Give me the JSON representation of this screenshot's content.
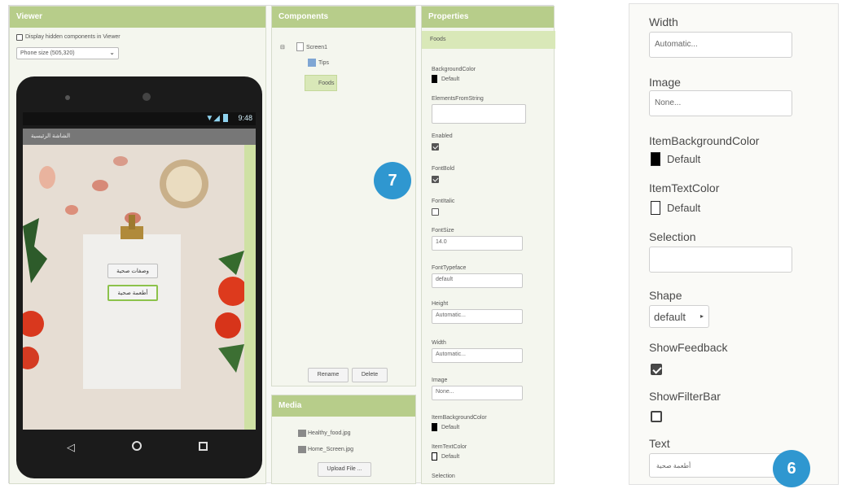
{
  "viewer": {
    "title": "Viewer",
    "hidden_components_label": "Display hidden components in Viewer",
    "phone_size": "Phone size (505,320)",
    "status_time": "9:48",
    "screen_title": "الشاشة الرئيسية",
    "buttons": [
      "وصفات صحية",
      "أطعمة صحية"
    ]
  },
  "components": {
    "title": "Components",
    "tree": [
      {
        "label": "Screen1",
        "level": 0
      },
      {
        "label": "Tips",
        "level": 1
      },
      {
        "label": "Foods",
        "level": 1
      }
    ],
    "rename_label": "Rename",
    "delete_label": "Delete"
  },
  "media": {
    "title": "Media",
    "files": [
      "Healthy_food.jpg",
      "Home_Screen.jpg"
    ],
    "upload_label": "Upload File ..."
  },
  "properties": {
    "title": "Properties",
    "component": "Foods",
    "background_color_label": "BackgroundColor",
    "background_color_value": "Default",
    "elements_label": "ElementsFromString",
    "enabled_label": "Enabled",
    "font_bold_label": "FontBold",
    "font_italic_label": "FontItalic",
    "font_size_label": "FontSize",
    "font_size_value": "14.0",
    "font_typeface_label": "FontTypeface",
    "font_typeface_value": "default",
    "height_label": "Height",
    "height_value": "Automatic...",
    "width_label": "Width",
    "width_value": "Automatic...",
    "image_label": "Image",
    "image_value": "None...",
    "item_bg_label": "ItemBackgroundColor",
    "item_bg_value": "Default",
    "item_text_label": "ItemTextColor",
    "item_text_value": "Default",
    "selection_label": "Selection"
  },
  "zoom": {
    "width_label": "Width",
    "width_value": "Automatic...",
    "image_label": "Image",
    "image_value": "None...",
    "item_bg_label": "ItemBackgroundColor",
    "item_bg_value": "Default",
    "item_text_label": "ItemTextColor",
    "item_text_value": "Default",
    "selection_label": "Selection",
    "shape_label": "Shape",
    "shape_value": "default",
    "show_feedback_label": "ShowFeedback",
    "show_filter_label": "ShowFilterBar",
    "text_label": "Text",
    "text_value": "أطعمة صحية"
  },
  "callouts": {
    "left": "7",
    "right": "6"
  },
  "colors": {
    "header": "#b7cd8a",
    "callout": "#2f97d0",
    "selected": "#d9e8b8"
  }
}
